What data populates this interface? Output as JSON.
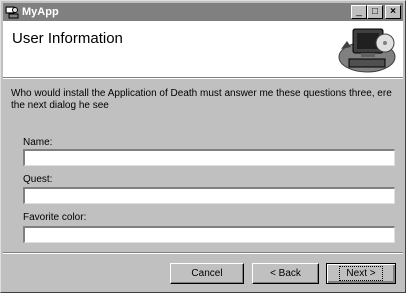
{
  "window": {
    "title": "MyApp",
    "minimize_label": "_",
    "maximize_label": "□",
    "close_label": "×"
  },
  "header": {
    "title": "User Information"
  },
  "intro_text": "Who would install the Application of Death must answer me these questions three, ere the next dialog he see",
  "fields": [
    {
      "label": "Name:",
      "value": ""
    },
    {
      "label": "Quest:",
      "value": ""
    },
    {
      "label": "Favorite color:",
      "value": ""
    }
  ],
  "buttons": {
    "cancel": "Cancel",
    "back": "< Back",
    "next": "Next >"
  },
  "icons": [
    "app-icon",
    "computer-disk-graphic"
  ],
  "colors": {
    "dialog_bg": "#c0c0c0",
    "titlebar_inactive": "#808080",
    "header_bg": "#ffffff"
  }
}
